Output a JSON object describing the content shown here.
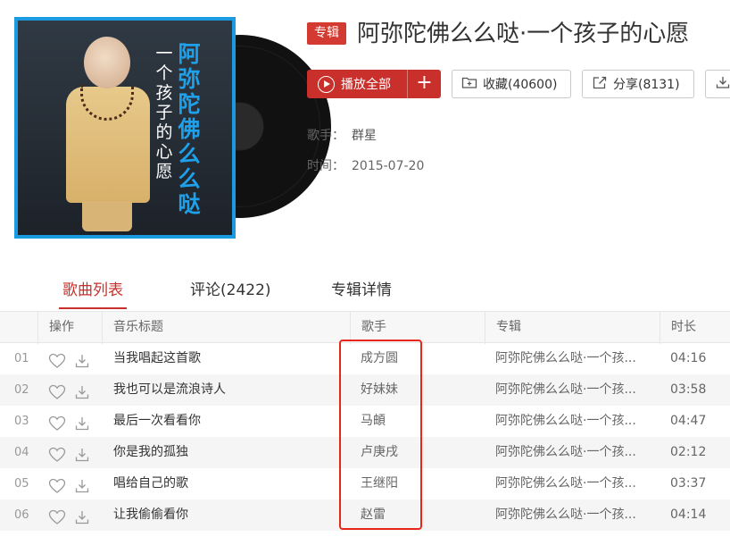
{
  "album": {
    "tag": "专辑",
    "title": "阿弥陀佛么么哒·一个孩子的心愿",
    "cover": {
      "title_text": "阿弥陀佛么么哒",
      "subtitle_text": "一个孩子的心愿"
    }
  },
  "actions": {
    "play_all": "播放全部",
    "add": "+",
    "favorite": "收藏(40600)",
    "share": "分享(8131)"
  },
  "meta": {
    "artist_label": "歌手：",
    "artist_value": "群星",
    "date_label": "时间：",
    "date_value": "2015-07-20"
  },
  "tabs": {
    "list": "歌曲列表",
    "comments": "评论(2422)",
    "detail": "专辑详情"
  },
  "table": {
    "headers": {
      "ops": "操作",
      "title": "音乐标题",
      "artist": "歌手",
      "album": "专辑",
      "duration": "时长"
    },
    "rows": [
      {
        "index": "01",
        "title": "当我唱起这首歌",
        "artist": "成方圆",
        "album": "阿弥陀佛么么哒·一个孩...",
        "duration": "04:16"
      },
      {
        "index": "02",
        "title": "我也可以是流浪诗人",
        "artist": "好妹妹",
        "album": "阿弥陀佛么么哒·一个孩...",
        "duration": "03:58"
      },
      {
        "index": "03",
        "title": "最后一次看看你",
        "artist": "马頔",
        "album": "阿弥陀佛么么哒·一个孩...",
        "duration": "04:47"
      },
      {
        "index": "04",
        "title": "你是我的孤独",
        "artist": "卢庚戌",
        "album": "阿弥陀佛么么哒·一个孩...",
        "duration": "02:12"
      },
      {
        "index": "05",
        "title": "唱给自己的歌",
        "artist": "王继阳",
        "album": "阿弥陀佛么么哒·一个孩...",
        "duration": "03:37"
      },
      {
        "index": "06",
        "title": "让我偷偷看你",
        "artist": "赵雷",
        "album": "阿弥陀佛么么哒·一个孩...",
        "duration": "04:14"
      }
    ]
  },
  "colors": {
    "accent": "#c9302c",
    "highlight_box": "#e8271b",
    "cover_border": "#1a9ae0"
  }
}
